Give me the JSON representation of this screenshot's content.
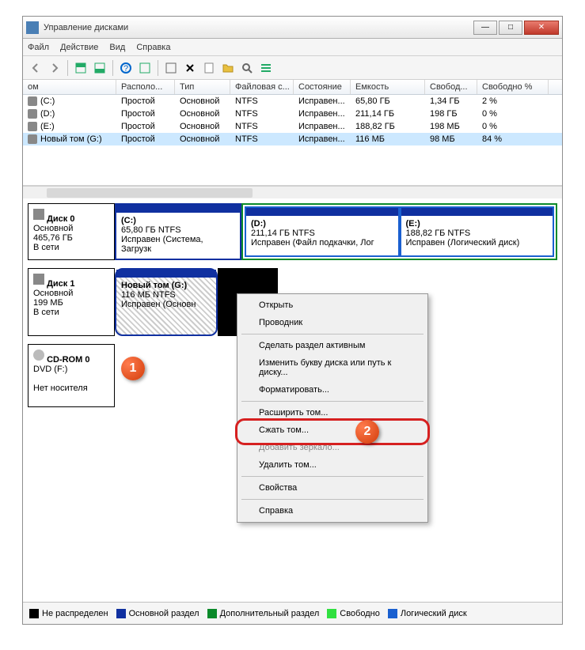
{
  "window": {
    "title": "Управление дисками"
  },
  "menu": {
    "file": "Файл",
    "action": "Действие",
    "view": "Вид",
    "help": "Справка"
  },
  "table": {
    "headers": [
      "ом",
      "Располо...",
      "Тип",
      "Файловая с...",
      "Состояние",
      "Емкость",
      "Свобод...",
      "Свободно %"
    ],
    "rows": [
      {
        "name": "(C:)",
        "layout": "Простой",
        "type": "Основной",
        "fs": "NTFS",
        "status": "Исправен...",
        "capacity": "65,80 ГБ",
        "free": "1,34 ГБ",
        "pct": "2 %"
      },
      {
        "name": "(D:)",
        "layout": "Простой",
        "type": "Основной",
        "fs": "NTFS",
        "status": "Исправен...",
        "capacity": "211,14 ГБ",
        "free": "198 ГБ",
        "pct": "0 %"
      },
      {
        "name": "(E:)",
        "layout": "Простой",
        "type": "Основной",
        "fs": "NTFS",
        "status": "Исправен...",
        "capacity": "188,82 ГБ",
        "free": "198 МБ",
        "pct": "0 %"
      },
      {
        "name": "Новый том  (G:)",
        "layout": "Простой",
        "type": "Основной",
        "fs": "NTFS",
        "status": "Исправен...",
        "capacity": "116 МБ",
        "free": "98 МБ",
        "pct": "84 %"
      }
    ]
  },
  "disks": {
    "disk0": {
      "name": "Диск 0",
      "type": "Основной",
      "size": "465,76 ГБ",
      "state": "В сети",
      "vols": [
        {
          "letter": "(C:)",
          "size": "65,80 ГБ NTFS",
          "status": "Исправен (Система, Загрузк"
        },
        {
          "letter": "(D:)",
          "size": "211,14 ГБ NTFS",
          "status": "Исправен (Файл подкачки, Лог"
        },
        {
          "letter": "(E:)",
          "size": "188,82 ГБ NTFS",
          "status": "Исправен (Логический диск)"
        }
      ]
    },
    "disk1": {
      "name": "Диск 1",
      "type": "Основной",
      "size": "199 МБ",
      "state": "В сети",
      "vol": {
        "letter": "Новый том  (G:)",
        "size": "116 МБ NTFS",
        "status": "Исправен (Основн"
      }
    },
    "cdrom": {
      "name": "CD-ROM 0",
      "dev": "DVD (F:)",
      "state": "Нет носителя"
    }
  },
  "context": {
    "open": "Открыть",
    "explorer": "Проводник",
    "active": "Сделать раздел активным",
    "change": "Изменить букву диска или путь к диску...",
    "format": "Форматировать...",
    "extend": "Расширить том...",
    "shrink": "Сжать том...",
    "mirror": "Добавить зеркало...",
    "delete": "Удалить том...",
    "props": "Свойства",
    "help": "Справка"
  },
  "legend": {
    "unalloc": "Не распределен",
    "primary": "Основной раздел",
    "extended": "Дополнительный раздел",
    "free": "Свободно",
    "logical": "Логический диск",
    "colors": {
      "unalloc": "#000000",
      "primary": "#1030a0",
      "extended": "#0a8a2a",
      "free": "#30e040",
      "logical": "#1a60d0"
    }
  },
  "badges": {
    "one": "1",
    "two": "2"
  }
}
